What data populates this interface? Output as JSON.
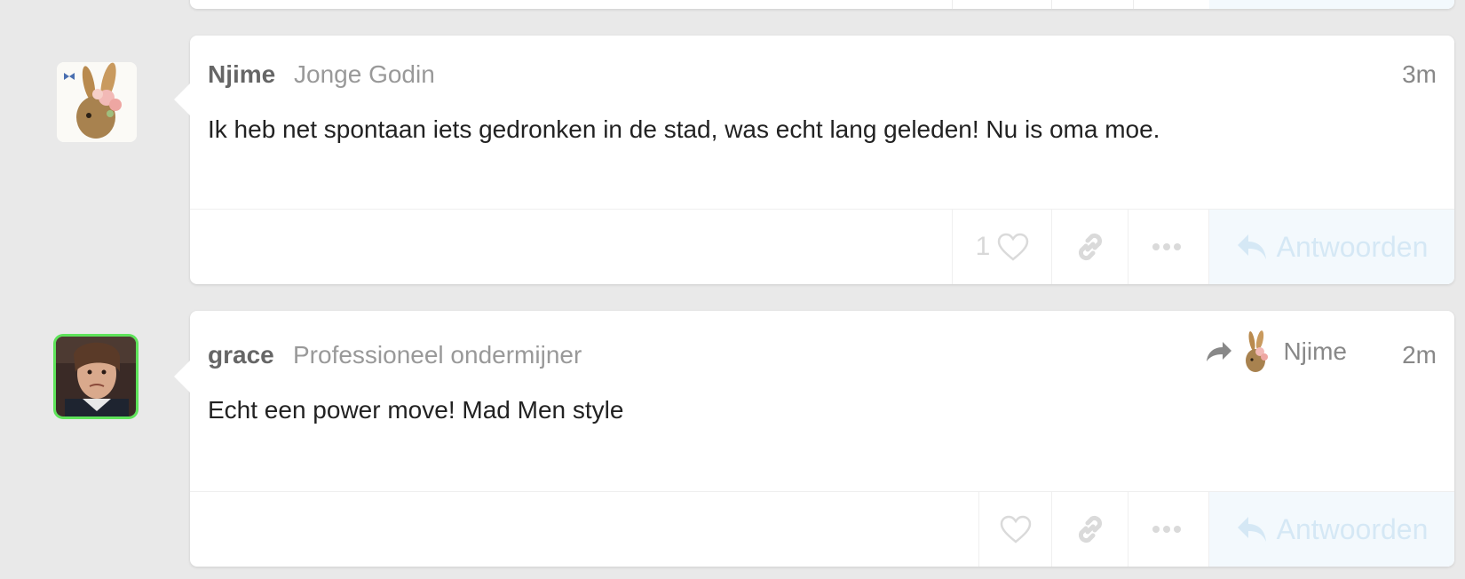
{
  "posts": [
    {
      "username": "Njime",
      "user_title": "Jonge Godin",
      "time": "3m",
      "body": "Ik heb net spontaan iets gedronken in de stad, was echt lang geleden! Nu is oma moe.",
      "like_count": "1",
      "reply_label": "Antwoorden",
      "icons": {
        "avatar": "rabbit-with-flowers-avatar",
        "like": "heart-icon",
        "link": "link-icon",
        "more": "more-dots-icon",
        "reply": "reply-arrow-icon"
      }
    },
    {
      "username": "grace",
      "user_title": "Professioneel ondermijner",
      "time": "2m",
      "body": "Echt een power move! Mad Men style",
      "reply_to_name": "Njime",
      "reply_label": "Antwoorden",
      "icons": {
        "avatar": "woman-photo-avatar",
        "reply_to": "share-arrow-icon",
        "like": "heart-icon",
        "link": "link-icon",
        "more": "more-dots-icon",
        "reply": "reply-arrow-icon"
      }
    }
  ],
  "colors": {
    "background": "#e9e9e9",
    "online_ring": "#5ee35a",
    "reply_bg": "#f3f9fd"
  }
}
